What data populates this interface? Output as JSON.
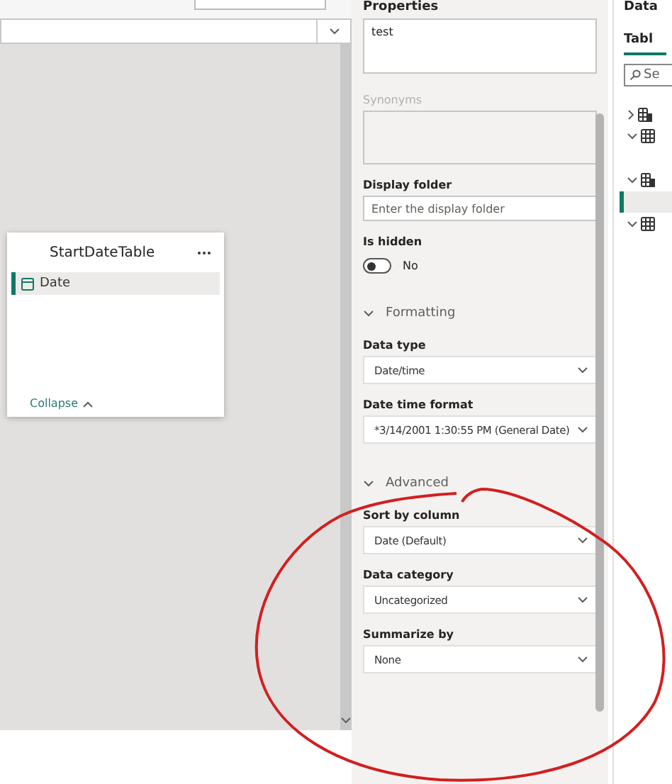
{
  "canvas": {
    "table_card": {
      "title": "StartDateTable",
      "fields": [
        {
          "name": "Date",
          "selected": true
        }
      ],
      "collapse": "Collapse"
    }
  },
  "properties": {
    "title": "Properties",
    "description": "test",
    "synonyms": {
      "label": "Synonyms",
      "disabled": true
    },
    "display_folder": {
      "label": "Display folder",
      "placeholder": "Enter the display folder"
    },
    "is_hidden": {
      "label": "Is hidden",
      "on": false,
      "state_text": "No"
    },
    "sections": [
      {
        "title": "Formatting",
        "expanded": true,
        "fields": [
          {
            "label": "Data type",
            "value": "Date/time"
          },
          {
            "label": "Date time format",
            "value": "*3/14/2001 1:30:55 PM (General Date)"
          }
        ]
      },
      {
        "title": "Advanced",
        "expanded": true,
        "fields": [
          {
            "label": "Sort by column",
            "value": "Date (Default)"
          },
          {
            "label": "Data category",
            "value": "Uncategorized"
          },
          {
            "label": "Summarize by",
            "value": "None"
          }
        ]
      }
    ]
  },
  "data_pane": {
    "title": "Data",
    "tabs": [
      {
        "label": "Tabl",
        "selected": true
      }
    ],
    "search": {
      "placeholder": "Se"
    },
    "tree": [
      {
        "kind": "calculated-table",
        "expanded": false,
        "selected": false
      },
      {
        "kind": "table",
        "expanded": true,
        "selected": false
      },
      {
        "kind": "calculated-table",
        "expanded": true,
        "selected": false
      },
      {
        "kind": "field",
        "selected": true
      },
      {
        "kind": "table",
        "expanded": true,
        "selected": false
      }
    ]
  }
}
